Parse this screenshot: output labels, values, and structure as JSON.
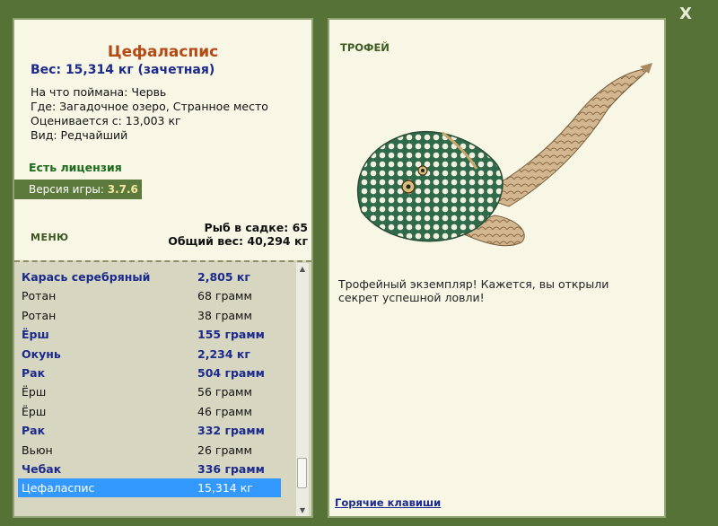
{
  "window": {
    "close_label": "X"
  },
  "catch": {
    "title": "Цефаласпис",
    "weight_line": "Вес: 15,314 кг (зачетная)",
    "bait": "На что поймана: Червь",
    "place": "Где: Загадочное озеро, Странное место",
    "threshold": "Оценивается с: 13,003 кг",
    "rarity": "Вид: Редчайший"
  },
  "license_label": "Есть лицензия",
  "version": {
    "label": "Версия игры: ",
    "value": "3.7.6"
  },
  "menu_label": "МЕНЮ",
  "stats": {
    "count": "Рыб в садке: 65",
    "total": "Общий вес: 40,294 кг"
  },
  "fish_list": [
    {
      "name": "Карась серебряный",
      "weight": "2,805 кг",
      "caught": true
    },
    {
      "name": "Ротан",
      "weight": "68 грамм",
      "caught": false
    },
    {
      "name": "Ротан",
      "weight": "38 грамм",
      "caught": false
    },
    {
      "name": "Ёрш",
      "weight": "155 грамм",
      "caught": true
    },
    {
      "name": "Окунь",
      "weight": "2,234 кг",
      "caught": true
    },
    {
      "name": "Рак",
      "weight": "504 грамм",
      "caught": true
    },
    {
      "name": "Ёрш",
      "weight": "56 грамм",
      "caught": false
    },
    {
      "name": "Ёрш",
      "weight": "46 грамм",
      "caught": false
    },
    {
      "name": "Рак",
      "weight": "332 грамм",
      "caught": true
    },
    {
      "name": "Вьюн",
      "weight": "26 грамм",
      "caught": false
    },
    {
      "name": "Чебак",
      "weight": "336 грамм",
      "caught": true
    },
    {
      "name": "Цефаласпис",
      "weight": "15,314 кг",
      "caught": true,
      "selected": true
    }
  ],
  "trophy": {
    "label": "ТРОФЕЙ",
    "text": "Трофейный экземпляр! Кажется, вы открыли секрет успешной ловли!"
  },
  "hotkeys_label": "Горячие клавиши",
  "colors": {
    "background": "#567236",
    "panel": "#f8f7e6",
    "caught_text": "#1b2a8c",
    "title": "#b44a16",
    "selection": "#3399ff"
  }
}
